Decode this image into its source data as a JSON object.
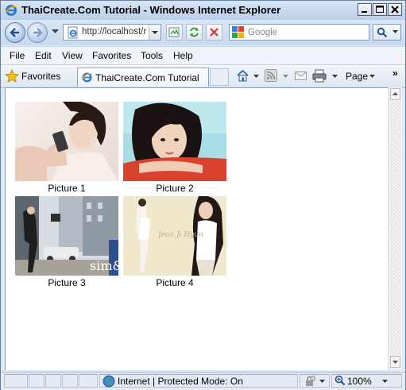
{
  "window": {
    "title": "ThaiCreate.Com Tutorial - Windows Internet Explorer",
    "minimize": "minimize",
    "maximize": "maximize",
    "close": "close"
  },
  "address_bar": {
    "url": "http://localhost/r"
  },
  "search": {
    "placeholder": "Google"
  },
  "menu": {
    "items": [
      "File",
      "Edit",
      "View",
      "Favorites",
      "Tools",
      "Help"
    ]
  },
  "favorites_bar": {
    "favorites_label": "Favorites",
    "tab_title": "ThaiCreate.Com Tutorial",
    "page_label": "Page",
    "overflow": "»"
  },
  "gallery": {
    "items": [
      {
        "caption": "Picture 1",
        "watermark": ""
      },
      {
        "caption": "Picture 2",
        "watermark": ""
      },
      {
        "caption": "Picture 3",
        "watermark": "sim&"
      },
      {
        "caption": "Picture 4",
        "watermark": "Jeon Ji Hyun"
      }
    ]
  },
  "status_bar": {
    "zone_text": "Internet | Protected Mode: On",
    "zoom": "100%"
  },
  "colors": {
    "accent": "#3a6fb0",
    "frame": "#dfe8f5"
  }
}
